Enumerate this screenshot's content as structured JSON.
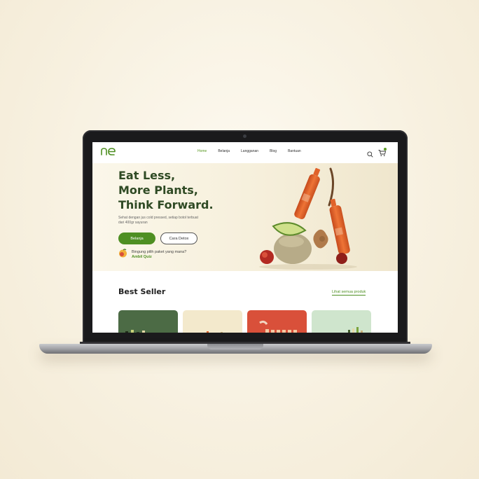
{
  "nav": {
    "logo_text": "ne",
    "links": [
      {
        "label": "Home",
        "active": true
      },
      {
        "label": "Belanja",
        "active": false
      },
      {
        "label": "Langganan",
        "active": false
      },
      {
        "label": "Blog",
        "active": false
      },
      {
        "label": "Bantuan",
        "active": false
      }
    ],
    "search_icon": "search-icon",
    "cart_icon": "cart-icon"
  },
  "hero": {
    "title_lines": [
      "Eat Less,",
      "More Plants,",
      "Think Forward."
    ],
    "subtitle": "Sehat dengan jus cold pressed, setiap botol terbuat dari 400gr sayuran",
    "primary_button": "Belanja",
    "secondary_button": "Cara Detox",
    "quiz_question": "Bingung pilih paket yang mana?",
    "quiz_link": "Ambil Quiz"
  },
  "best_seller": {
    "title": "Best Seller",
    "see_all": "Lihat semua produk",
    "cards": [
      {
        "name": "product-card-green"
      },
      {
        "name": "product-card-cream"
      },
      {
        "name": "product-card-red"
      },
      {
        "name": "product-card-mint"
      }
    ]
  },
  "colors": {
    "brand_green": "#4e8f22",
    "title_green": "#2f4a24",
    "hero_bg": "#f6efdb",
    "bottle_orange": "#e0622a"
  }
}
